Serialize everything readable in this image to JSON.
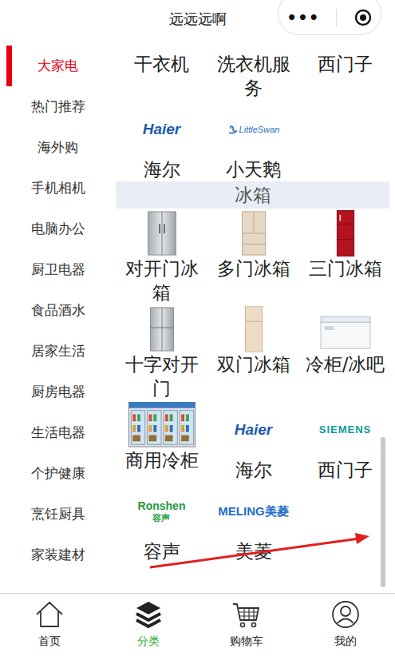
{
  "header": {
    "title": "远远远啊",
    "more": "•••"
  },
  "sidebar": {
    "items": [
      {
        "label": "大家电",
        "selected": true
      },
      {
        "label": "热门推荐",
        "selected": false
      },
      {
        "label": "海外购",
        "selected": false
      },
      {
        "label": "手机相机",
        "selected": false
      },
      {
        "label": "电脑办公",
        "selected": false
      },
      {
        "label": "厨卫电器",
        "selected": false
      },
      {
        "label": "食品酒水",
        "selected": false
      },
      {
        "label": "居家生活",
        "selected": false
      },
      {
        "label": "厨房电器",
        "selected": false
      },
      {
        "label": "生活电器",
        "selected": false
      },
      {
        "label": "个护健康",
        "selected": false
      },
      {
        "label": "烹饪厨具",
        "selected": false
      },
      {
        "label": "家装建材",
        "selected": false
      }
    ]
  },
  "content": {
    "items_above": [
      {
        "label": "干衣机",
        "kind": "clipped"
      },
      {
        "label": "洗衣机服务",
        "kind": "clipped"
      },
      {
        "label": "西门子",
        "kind": "clipped"
      },
      {
        "label": "海尔",
        "kind": "logo",
        "logo": "Haier",
        "color": "#1b5cb0"
      },
      {
        "label": "小天鹅",
        "kind": "logo",
        "logo": "LittleSwan",
        "color": "#2a6fc7"
      }
    ],
    "sections": [
      {
        "title": "冰箱",
        "items": [
          {
            "label": "对开门冰箱",
            "kind": "photo"
          },
          {
            "label": "多门冰箱",
            "kind": "photo"
          },
          {
            "label": "三门冰箱",
            "kind": "photo"
          },
          {
            "label": "十字对开门",
            "kind": "photo"
          },
          {
            "label": "双门冰箱",
            "kind": "photo"
          },
          {
            "label": "冷柜/冰吧",
            "kind": "photo"
          },
          {
            "label": "商用冷柜",
            "kind": "photo"
          },
          {
            "label": "海尔",
            "kind": "logo",
            "logo": "Haier",
            "color": "#1b5cb0"
          },
          {
            "label": "西门子",
            "kind": "logo",
            "logo": "SIEMENS",
            "color": "#0a9a9a"
          },
          {
            "label": "容声",
            "kind": "logo",
            "logo": "Ronshen",
            "logo_sub": "容声",
            "color": "#1f9a3e"
          },
          {
            "label": "美菱",
            "kind": "logo",
            "logo": "MELING美菱",
            "color": "#1e6ec8"
          }
        ]
      }
    ]
  },
  "tabbar": {
    "tabs": [
      {
        "label": "首页",
        "selected": false
      },
      {
        "label": "分类",
        "selected": true
      },
      {
        "label": "购物车",
        "selected": false
      },
      {
        "label": "我的",
        "selected": false
      }
    ]
  }
}
